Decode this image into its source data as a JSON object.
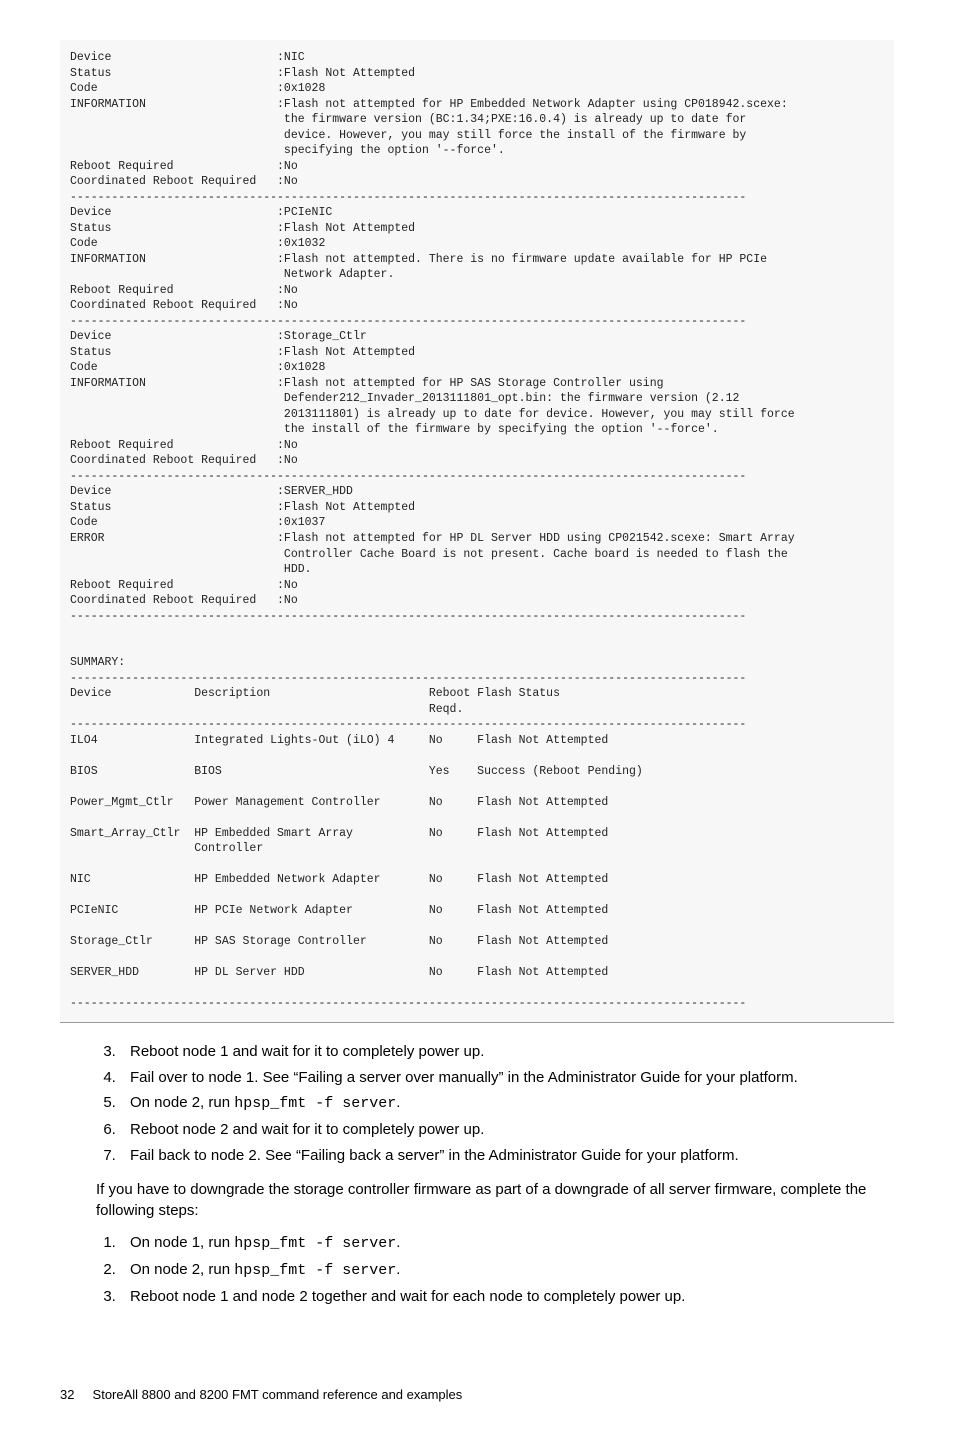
{
  "codeblock": {
    "labelPad": 30,
    "valuePad": 74,
    "hr": "--------------------------------------------------------------------------------------------------",
    "blocks": [
      {
        "rows": [
          {
            "k": "Device",
            "v": "NIC"
          },
          {
            "k": "Status",
            "v": "Flash Not Attempted"
          },
          {
            "k": "Code",
            "v": "0x1028"
          },
          {
            "k": "INFORMATION",
            "v": "Flash not attempted for HP Embedded Network Adapter using CP018942.scexe: the firmware version (BC:1.34;PXE:16.0.4) is already up to date for device. However, you may still force the install of the firmware by specifying the option '--force'."
          },
          {
            "k": "Reboot Required",
            "v": "No"
          },
          {
            "k": "Coordinated Reboot Required",
            "v": "No"
          }
        ]
      },
      {
        "rows": [
          {
            "k": "Device",
            "v": "PCIeNIC"
          },
          {
            "k": "Status",
            "v": "Flash Not Attempted"
          },
          {
            "k": "Code",
            "v": "0x1032"
          },
          {
            "k": "INFORMATION",
            "v": "Flash not attempted. There is no firmware update available for HP PCIe Network Adapter."
          },
          {
            "k": "Reboot Required",
            "v": "No"
          },
          {
            "k": "Coordinated Reboot Required",
            "v": "No"
          }
        ]
      },
      {
        "rows": [
          {
            "k": "Device",
            "v": "Storage_Ctlr"
          },
          {
            "k": "Status",
            "v": "Flash Not Attempted"
          },
          {
            "k": "Code",
            "v": "0x1028"
          },
          {
            "k": "INFORMATION",
            "v": "Flash not attempted for HP SAS Storage Controller using Defender212_Invader_2013111801_opt.bin: the firmware version (2.12 2013111801) is already up to date for device. However, you may still force the install of the firmware by specifying the option '--force'."
          },
          {
            "k": "Reboot Required",
            "v": "No"
          },
          {
            "k": "Coordinated Reboot Required",
            "v": "No"
          }
        ]
      },
      {
        "rows": [
          {
            "k": "Device",
            "v": "SERVER_HDD"
          },
          {
            "k": "Status",
            "v": "Flash Not Attempted"
          },
          {
            "k": "Code",
            "v": "0x1037"
          },
          {
            "k": "ERROR",
            "v": "Flash not attempted for HP DL Server HDD using CP021542.scexe: Smart Array Controller Cache Board is not present. Cache board is needed to flash the HDD."
          },
          {
            "k": "Reboot Required",
            "v": "No"
          },
          {
            "k": "Coordinated Reboot Required",
            "v": "No"
          }
        ]
      }
    ],
    "summary": {
      "title": "SUMMARY:",
      "col": {
        "device": {
          "label": "Device",
          "width": 18
        },
        "desc": {
          "label": "Description",
          "width": 34
        },
        "reboot": {
          "label": "Reboot",
          "label2": "Reqd.",
          "width": 7
        },
        "status": {
          "label": "Flash Status"
        }
      },
      "rows": [
        {
          "device": "ILO4",
          "desc": "Integrated Lights-Out (iLO) 4",
          "reboot": "No",
          "status": "Flash Not Attempted"
        },
        {
          "device": "BIOS",
          "desc": "BIOS",
          "reboot": "Yes",
          "status": "Success (Reboot Pending)"
        },
        {
          "device": "Power_Mgmt_Ctlr",
          "desc": "Power Management Controller",
          "reboot": "No",
          "status": "Flash Not Attempted"
        },
        {
          "device": "Smart_Array_Ctlr",
          "desc": "HP Embedded Smart Array Controller",
          "reboot": "No",
          "status": "Flash Not Attempted"
        },
        {
          "device": "NIC",
          "desc": "HP Embedded Network Adapter",
          "reboot": "No",
          "status": "Flash Not Attempted"
        },
        {
          "device": "PCIeNIC",
          "desc": "HP PCIe Network Adapter",
          "reboot": "No",
          "status": "Flash Not Attempted"
        },
        {
          "device": "Storage_Ctlr",
          "desc": "HP SAS Storage Controller",
          "reboot": "No",
          "status": "Flash Not Attempted"
        },
        {
          "device": "SERVER_HDD",
          "desc": "HP DL Server HDD",
          "reboot": "No",
          "status": "Flash Not Attempted"
        }
      ]
    }
  },
  "stepsA": {
    "start": 3,
    "items": [
      {
        "text": "Reboot node 1 and wait for it to completely power up."
      },
      {
        "text": "Fail over to node 1. See “Failing a server over manually” in the Administrator Guide for your platform."
      },
      {
        "text": "On node 2, run ",
        "code": "hpsp_fmt -f server",
        "tail": "."
      },
      {
        "text": "Reboot node 2 and wait for it to completely power up."
      },
      {
        "text": "Fail back to node 2. See “Failing back a server” in the Administrator Guide for your platform."
      }
    ]
  },
  "para1": "If you have to downgrade the storage controller firmware as part of a downgrade of all server firmware, complete the following steps:",
  "stepsB": {
    "start": 1,
    "items": [
      {
        "text": "On node 1, run ",
        "code": "hpsp_fmt -f server",
        "tail": "."
      },
      {
        "text": "On node 2, run ",
        "code": "hpsp_fmt -f server",
        "tail": "."
      },
      {
        "text": "Reboot node 1 and node 2 together and wait for each node to completely power up."
      }
    ]
  },
  "footer": {
    "pageNum": "32",
    "title": "StoreAll 8800 and 8200 FMT command reference and examples"
  }
}
